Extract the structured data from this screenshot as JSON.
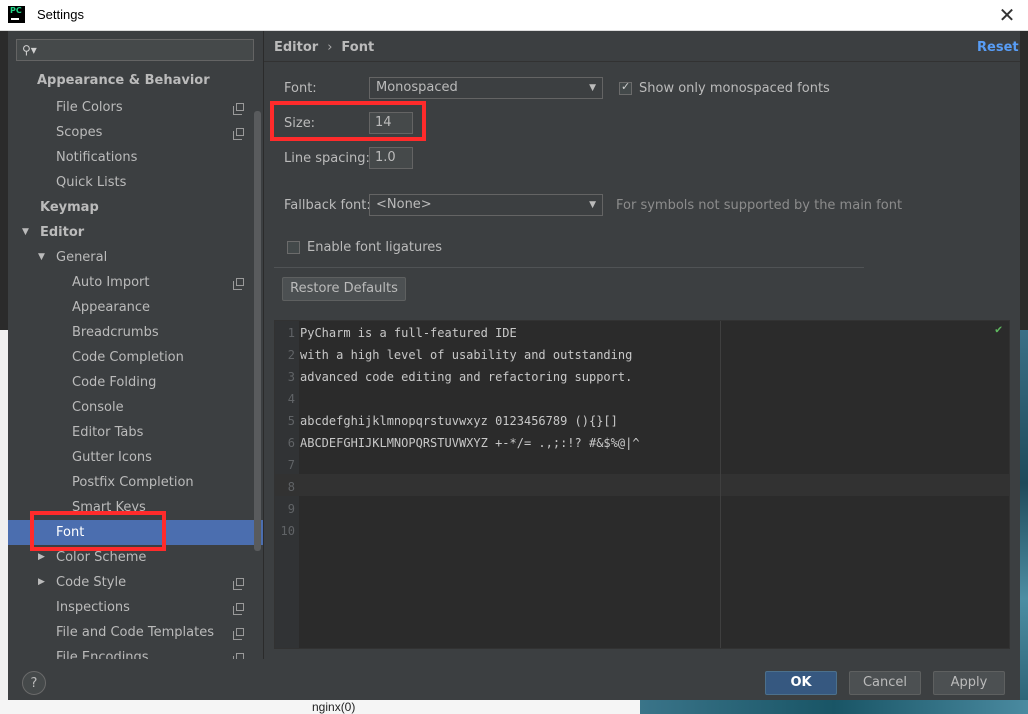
{
  "window": {
    "title": "Settings",
    "app_icon_text": "PC"
  },
  "background": {
    "bottom_text": "nginx(0)"
  },
  "sidebar": {
    "search_placeholder": "",
    "items": [
      {
        "label": "Appearance & Behavior"
      },
      {
        "label": "File Colors"
      },
      {
        "label": "Scopes"
      },
      {
        "label": "Notifications"
      },
      {
        "label": "Quick Lists"
      },
      {
        "label": "Keymap"
      },
      {
        "label": "Editor"
      },
      {
        "label": "General"
      },
      {
        "label": "Auto Import"
      },
      {
        "label": "Appearance"
      },
      {
        "label": "Breadcrumbs"
      },
      {
        "label": "Code Completion"
      },
      {
        "label": "Code Folding"
      },
      {
        "label": "Console"
      },
      {
        "label": "Editor Tabs"
      },
      {
        "label": "Gutter Icons"
      },
      {
        "label": "Postfix Completion"
      },
      {
        "label": "Smart Keys"
      },
      {
        "label": "Font"
      },
      {
        "label": "Color Scheme"
      },
      {
        "label": "Code Style"
      },
      {
        "label": "Inspections"
      },
      {
        "label": "File and Code Templates"
      },
      {
        "label": "File Encodings"
      }
    ],
    "selected": "Font"
  },
  "content": {
    "breadcrumb": [
      "Editor",
      "Font"
    ],
    "breadcrumb_sep": "›",
    "reset_label": "Reset",
    "font_label": "Font:",
    "font_value": "Monospaced",
    "show_mono_label": "Show only monospaced fonts",
    "show_mono_checked": true,
    "size_label": "Size:",
    "size_value": "14",
    "line_spacing_label": "Line spacing:",
    "line_spacing_value": "1.0",
    "fallback_label": "Fallback font:",
    "fallback_value": "<None>",
    "fallback_hint": "For symbols not supported by the main font",
    "ligatures_label": "Enable font ligatures",
    "ligatures_checked": false,
    "restore_label": "Restore Defaults"
  },
  "preview": {
    "line_numbers": [
      "1",
      "2",
      "3",
      "4",
      "5",
      "6",
      "7",
      "8",
      "9",
      "10"
    ],
    "lines": [
      "PyCharm is a full-featured IDE",
      "with a high level of usability and outstanding",
      "advanced code editing and refactoring support.",
      "",
      "abcdefghijklmnopqrstuvwxyz 0123456789 (){}[]",
      "ABCDEFGHIJKLMNOPQRSTUVWXYZ +-*/= .,;:!? #&$%@|^",
      "",
      "",
      "",
      ""
    ]
  },
  "footer": {
    "help_label": "?",
    "ok_label": "OK",
    "cancel_label": "Cancel",
    "apply_label": "Apply"
  },
  "colors": {
    "accent": "#4b6eaf",
    "link": "#589df6",
    "highlight": "#ff2b2b",
    "ok_button": "#365880"
  }
}
